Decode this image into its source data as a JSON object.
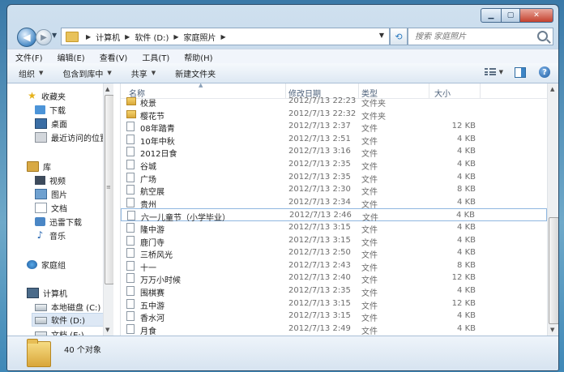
{
  "address": {
    "crumbs": [
      "计算机",
      "软件 (D:)",
      "家庭照片"
    ]
  },
  "search": {
    "placeholder": "搜索 家庭照片"
  },
  "menu": [
    "文件(F)",
    "编辑(E)",
    "查看(V)",
    "工具(T)",
    "帮助(H)"
  ],
  "toolbar": {
    "organize": "组织",
    "include_library": "包含到库中",
    "share": "共享",
    "new_folder": "新建文件夹"
  },
  "nav": {
    "favorites": "收藏夹",
    "downloads": "下载",
    "desktop": "桌面",
    "recent": "最近访问的位置",
    "libraries": "库",
    "videos": "视频",
    "pictures": "图片",
    "documents": "文档",
    "thunder": "迅雷下载",
    "music": "音乐",
    "homegroup": "家庭组",
    "computer": "计算机",
    "drive_c": "本地磁盘 (C:)",
    "drive_d": "软件 (D:)",
    "drive_e": "文档 (E:)"
  },
  "columns": {
    "name": "名称",
    "date": "修改日期",
    "type": "类型",
    "size": "大小"
  },
  "files": [
    {
      "name": "校景",
      "date": "2012/7/13 22:23",
      "type": "文件夹",
      "size": "",
      "kind": "folder"
    },
    {
      "name": "樱花节",
      "date": "2012/7/13 22:32",
      "type": "文件夹",
      "size": "",
      "kind": "folder"
    },
    {
      "name": "08年踏青",
      "date": "2012/7/13 2:37",
      "type": "文件",
      "size": "12 KB",
      "kind": "file"
    },
    {
      "name": "10年中秋",
      "date": "2012/7/13 2:51",
      "type": "文件",
      "size": "4 KB",
      "kind": "file"
    },
    {
      "name": "2012日食",
      "date": "2012/7/13 3:16",
      "type": "文件",
      "size": "4 KB",
      "kind": "file"
    },
    {
      "name": "谷城",
      "date": "2012/7/13 2:35",
      "type": "文件",
      "size": "4 KB",
      "kind": "file"
    },
    {
      "name": "广场",
      "date": "2012/7/13 2:35",
      "type": "文件",
      "size": "4 KB",
      "kind": "file"
    },
    {
      "name": "航空展",
      "date": "2012/7/13 2:30",
      "type": "文件",
      "size": "8 KB",
      "kind": "file"
    },
    {
      "name": "贵州",
      "date": "2012/7/13 2:34",
      "type": "文件",
      "size": "4 KB",
      "kind": "file"
    },
    {
      "name": "六一儿童节（小学毕业）",
      "date": "2012/7/13 2:46",
      "type": "文件",
      "size": "4 KB",
      "kind": "file",
      "selected": true
    },
    {
      "name": "隆中游",
      "date": "2012/7/13 3:15",
      "type": "文件",
      "size": "4 KB",
      "kind": "file"
    },
    {
      "name": "鹿门寺",
      "date": "2012/7/13 3:15",
      "type": "文件",
      "size": "4 KB",
      "kind": "file"
    },
    {
      "name": "三桥风光",
      "date": "2012/7/13 2:50",
      "type": "文件",
      "size": "4 KB",
      "kind": "file"
    },
    {
      "name": "十一",
      "date": "2012/7/13 2:43",
      "type": "文件",
      "size": "8 KB",
      "kind": "file"
    },
    {
      "name": "万万小时候",
      "date": "2012/7/13 2:40",
      "type": "文件",
      "size": "12 KB",
      "kind": "file"
    },
    {
      "name": "围棋赛",
      "date": "2012/7/13 2:35",
      "type": "文件",
      "size": "4 KB",
      "kind": "file"
    },
    {
      "name": "五中游",
      "date": "2012/7/13 3:15",
      "type": "文件",
      "size": "12 KB",
      "kind": "file"
    },
    {
      "name": "香水河",
      "date": "2012/7/13 3:15",
      "type": "文件",
      "size": "4 KB",
      "kind": "file"
    },
    {
      "name": "月食",
      "date": "2012/7/13 2:49",
      "type": "文件",
      "size": "4 KB",
      "kind": "file"
    }
  ],
  "status": {
    "count": "40 个对象"
  }
}
